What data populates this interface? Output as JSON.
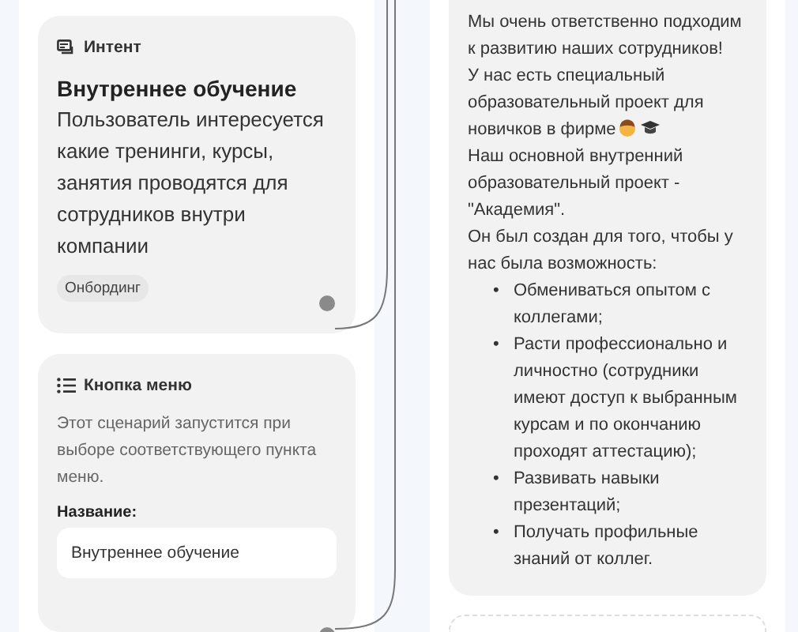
{
  "intent_card": {
    "header": "Интент",
    "title": "Внутреннее обучение",
    "description": "Пользователь интересуется какие тренинги, курсы, занятия проводятся для сотрудников внутри компании",
    "tags": [
      "Онбординг"
    ]
  },
  "menu_button_card": {
    "header": "Кнопка меню",
    "description": "Этот сценарий запустится при выборе соответствующего пункта меню.",
    "field_label": "Название:",
    "field_value": "Внутреннее обучение"
  },
  "message_card": {
    "paragraphs": [
      {
        "text": "Мы очень ответственно подходим к развитию наших сотрудников!"
      },
      {
        "text": "У нас есть специальный образовательный проект для новичков в фирме",
        "emoji": true
      },
      {
        "text": "Наш основной внутренний образовательный проект - \"Академия\"."
      },
      {
        "text": "Он был создан для того, чтобы у нас была возможность:"
      }
    ],
    "bullets": [
      {
        "marker": "•",
        "text": "Обмениваться опытом с коллегами;"
      },
      {
        "marker": "•",
        "text": "Расти профессионально и личностно (сотрудники имеют доступ к выбранным курсам и по окончанию проходят аттестацию);"
      },
      {
        "marker": "•",
        "text": "Развивать навыки презентаций;"
      },
      {
        "marker": "•",
        "text": "Получать профильные знаний от коллег."
      }
    ]
  }
}
